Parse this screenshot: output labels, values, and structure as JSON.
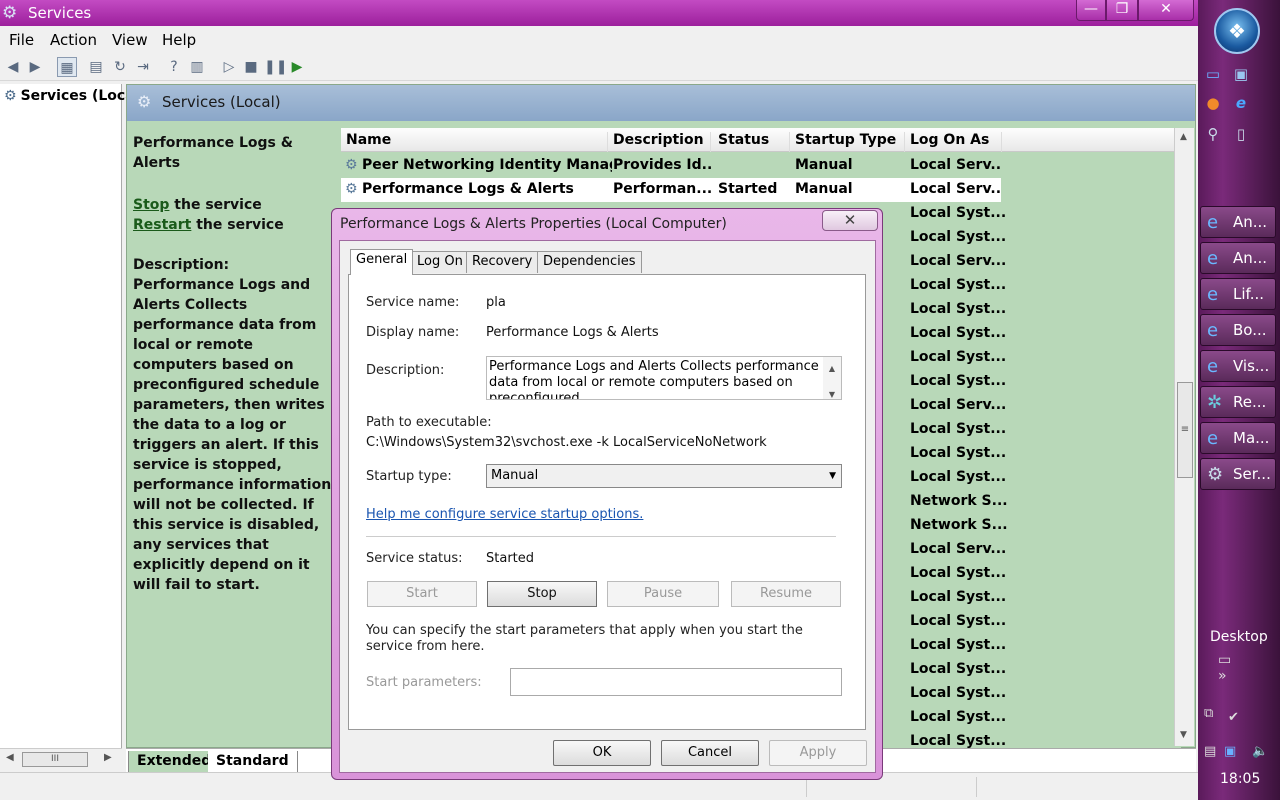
{
  "window": {
    "title": "Services",
    "min": "—",
    "max": "❐",
    "close": "✕"
  },
  "menu": [
    "File",
    "Action",
    "View",
    "Help"
  ],
  "tree": {
    "root_label": "Services (Loca"
  },
  "pane": {
    "header": "Services (Local)",
    "selected_title": "Performance Logs & Alerts",
    "stop_link": "Stop",
    "stop_suffix": " the service",
    "restart_link": "Restart",
    "restart_suffix": " the service",
    "desc_label": "Description:",
    "desc_text": "Performance Logs and Alerts Collects performance data from local or remote computers based on preconfigured schedule parameters, then writes the data to a log or triggers an alert. If this service is stopped, performance information will not be collected. If this service is disabled, any services that explicitly depend on it will fail to start."
  },
  "list": {
    "columns": [
      "Name",
      "Description",
      "Status",
      "Startup Type",
      "Log On As"
    ],
    "rows": [
      {
        "name": "Peer Networking Identity Manager",
        "description": "Provides Id...",
        "status": "",
        "startup": "Manual",
        "logon": "Local Serv..."
      },
      {
        "name": "Performance Logs & Alerts",
        "description": "Performan...",
        "status": "Started",
        "startup": "Manual",
        "logon": "Local Serv..."
      }
    ],
    "logon_rest": [
      "Local Syst...",
      "Local Syst...",
      "Local Serv...",
      "Local Syst...",
      "Local Syst...",
      "Local Syst...",
      "Local Syst...",
      "Local Syst...",
      "Local Serv...",
      "Local Syst...",
      "Local Syst...",
      "Local Syst...",
      "Network S...",
      "Network S...",
      "Local Serv...",
      "Local Syst...",
      "Local Syst...",
      "Local Syst...",
      "Local Syst...",
      "Local Syst...",
      "Local Syst...",
      "Local Syst...",
      "Local Syst..."
    ]
  },
  "bottom_tabs": {
    "extended": "Extended",
    "standard": "Standard"
  },
  "dialog": {
    "title": "Performance Logs & Alerts Properties (Local Computer)",
    "close": "✕",
    "tabs": [
      "General",
      "Log On",
      "Recovery",
      "Dependencies"
    ],
    "service_name_label": "Service name:",
    "service_name": "pla",
    "display_name_label": "Display name:",
    "display_name": "Performance Logs & Alerts",
    "description_label": "Description:",
    "description": "Performance Logs and Alerts Collects performance data from local or remote computers based on preconfigured",
    "path_label": "Path to executable:",
    "path": "C:\\Windows\\System32\\svchost.exe -k LocalServiceNoNetwork",
    "startup_label": "Startup type:",
    "startup_value": "Manual",
    "help_link": "Help me configure service startup options.",
    "status_label": "Service status:",
    "status_value": "Started",
    "btn_start": "Start",
    "btn_stop": "Stop",
    "btn_pause": "Pause",
    "btn_resume": "Resume",
    "specify_text": "You can specify the start parameters that apply when you start the service from here.",
    "params_label": "Start parameters:",
    "params_value": "",
    "btn_ok": "OK",
    "btn_cancel": "Cancel",
    "btn_apply": "Apply"
  },
  "taskbar": {
    "tasks": [
      "An...",
      "An...",
      "Lif...",
      "Bo...",
      "Vis...",
      "Re...",
      "Ma...",
      "Ser..."
    ],
    "desktop": "Desktop",
    "clock": "18:05"
  }
}
